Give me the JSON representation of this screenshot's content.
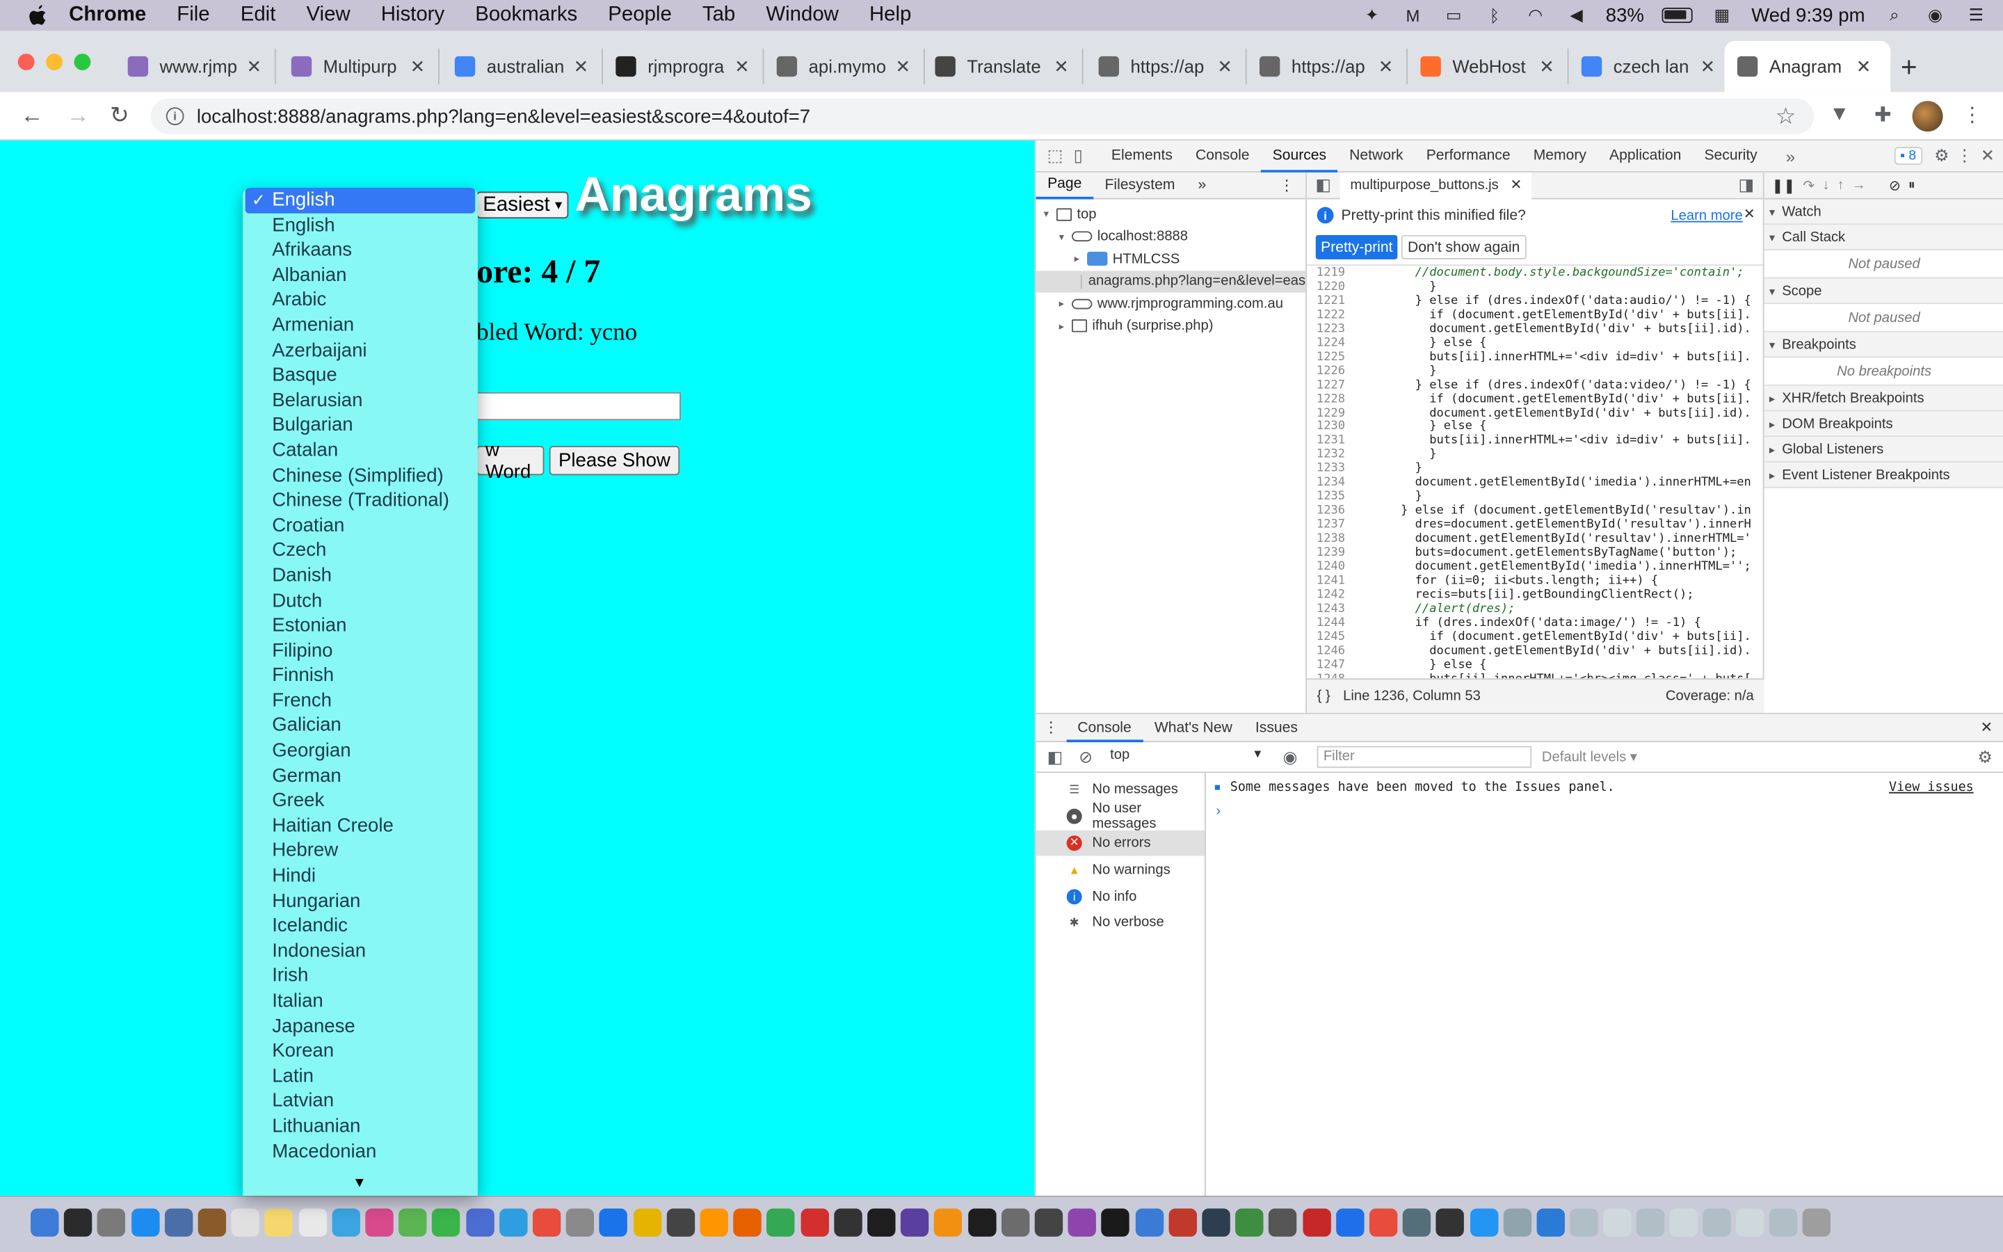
{
  "menubar": {
    "app": "Chrome",
    "items": [
      "File",
      "Edit",
      "View",
      "History",
      "Bookmarks",
      "People",
      "Tab",
      "Window",
      "Help"
    ],
    "battery": "83%",
    "clock": "Wed 9:39 pm"
  },
  "tabs": [
    {
      "label": "www.rjmp",
      "icon": "rocket-icon",
      "color": "#8a6bbd"
    },
    {
      "label": "Multipurp",
      "icon": "rocket-icon",
      "color": "#8a6bbd"
    },
    {
      "label": "australian",
      "icon": "google-icon",
      "color": "#4285f4"
    },
    {
      "label": "rjmprogra",
      "icon": "a-icon",
      "color": "#222222"
    },
    {
      "label": "api.mymo",
      "icon": "globe-icon",
      "color": "#666666"
    },
    {
      "label": "Translate",
      "icon": "translate-icon",
      "color": "#444444"
    },
    {
      "label": "https://ap",
      "icon": "globe-icon",
      "color": "#666666"
    },
    {
      "label": "https://ap",
      "icon": "globe-icon",
      "color": "#666666"
    },
    {
      "label": "WebHost",
      "icon": "cpanel-icon",
      "color": "#ff6c2c"
    },
    {
      "label": "czech lan",
      "icon": "google-icon",
      "color": "#4285f4"
    },
    {
      "label": "Anagram",
      "icon": "globe-icon",
      "color": "#666666"
    }
  ],
  "address": {
    "url": "localhost:8888/anagrams.php?lang=en&level=easiest&score=4&outof=7"
  },
  "page": {
    "level_select": "Easiest",
    "heading": "Anagrams",
    "score_text": "ore: 4 / 7",
    "scrambled_text": "bled Word: ycno",
    "new_word_button": "w Word",
    "please_show_button": "Please Show"
  },
  "dropdown": {
    "selected": "English",
    "options": [
      "English",
      "Afrikaans",
      "Albanian",
      "Arabic",
      "Armenian",
      "Azerbaijani",
      "Basque",
      "Belarusian",
      "Bulgarian",
      "Catalan",
      "Chinese (Simplified)",
      "Chinese (Traditional)",
      "Croatian",
      "Czech",
      "Danish",
      "Dutch",
      "Estonian",
      "Filipino",
      "Finnish",
      "French",
      "Galician",
      "Georgian",
      "German",
      "Greek",
      "Haitian Creole",
      "Hebrew",
      "Hindi",
      "Hungarian",
      "Icelandic",
      "Indonesian",
      "Irish",
      "Italian",
      "Japanese",
      "Korean",
      "Latin",
      "Latvian",
      "Lithuanian",
      "Macedonian"
    ]
  },
  "devtools": {
    "tabs": [
      "Elements",
      "Console",
      "Sources",
      "Network",
      "Performance",
      "Memory",
      "Application",
      "Security"
    ],
    "active_tab": "Sources",
    "issues_count": "8",
    "nav_tabs": [
      "Page",
      "Filesystem"
    ],
    "tree": [
      {
        "label": "top",
        "depth": 0
      },
      {
        "label": "localhost:8888",
        "depth": 1
      },
      {
        "label": "HTMLCSS",
        "depth": 2
      },
      {
        "label": "anagrams.php?lang=en&level=eas",
        "depth": 2
      },
      {
        "label": "www.rjmprogramming.com.au",
        "depth": 1
      },
      {
        "label": "ifhuh (surprise.php)",
        "depth": 1
      }
    ],
    "editor_file": "multipurpose_buttons.js",
    "pretty_prompt": "Pretty-print this minified file?",
    "learn_more": "Learn more",
    "pretty_btn": "Pretty-print",
    "dont_show_btn": "Don't show again",
    "line_numbers": [
      "1219",
      "1220",
      "1221",
      "1222",
      "1223",
      "1224",
      "1225",
      "1226",
      "1227",
      "1228",
      "1229",
      "1230",
      "1231",
      "1232",
      "1233",
      "1234",
      "1235",
      "1236",
      "1237",
      "1238",
      "1239",
      "1240",
      "1241",
      "1242",
      "1243",
      "1244",
      "1245",
      "1246",
      "1247",
      "1248"
    ],
    "code_lines": [
      "        //document.body.style.backgoundSize='contain';",
      "          }",
      "        } else if (dres.indexOf('data:audio/') != -1) {",
      "          if (document.getElementById('div' + buts[ii].",
      "          document.getElementById('div' + buts[ii].id).",
      "          } else {",
      "          buts[ii].innerHTML+='<div id=div' + buts[ii].",
      "          }",
      "        } else if (dres.indexOf('data:video/') != -1) {",
      "          if (document.getElementById('div' + buts[ii].",
      "          document.getElementById('div' + buts[ii].id).",
      "          } else {",
      "          buts[ii].innerHTML+='<div id=div' + buts[ii].",
      "          }",
      "        }",
      "        document.getElementById('imedia').innerHTML+=en",
      "        }",
      "      } else if (document.getElementById('resultav').in",
      "        dres=document.getElementById('resultav').innerH",
      "        document.getElementById('resultav').innerHTML='",
      "        buts=document.getElementsByTagName('button');",
      "        document.getElementById('imedia').innerHTML='';",
      "        for (ii=0; ii<buts.length; ii++) {",
      "        recis=buts[ii].getBoundingClientRect();",
      "        //alert(dres);",
      "        if (dres.indexOf('data:image/') != -1) {",
      "          if (document.getElementById('div' + buts[ii].",
      "          document.getElementById('div' + buts[ii].id).",
      "          } else {",
      "          buts[ii].innerHTML+='<br><img class=' + buts["
    ],
    "status_position": "Line 1236, Column 53",
    "coverage": "Coverage: n/a",
    "debug_sections": [
      {
        "label": "Watch",
        "open": true,
        "body": ""
      },
      {
        "label": "Call Stack",
        "open": true,
        "body": "Not paused"
      },
      {
        "label": "Scope",
        "open": true,
        "body": "Not paused"
      },
      {
        "label": "Breakpoints",
        "open": true,
        "body": "No breakpoints"
      },
      {
        "label": "XHR/fetch Breakpoints",
        "open": false,
        "body": ""
      },
      {
        "label": "DOM Breakpoints",
        "open": false,
        "body": ""
      },
      {
        "label": "Global Listeners",
        "open": false,
        "body": ""
      },
      {
        "label": "Event Listener Breakpoints",
        "open": false,
        "body": ""
      }
    ],
    "drawer_tabs": [
      "Console",
      "What's New",
      "Issues"
    ],
    "console_context": "top",
    "filter_placeholder": "Filter",
    "levels": "Default levels ▾",
    "console_sidebar": [
      {
        "label": "No messages",
        "icon": "list-icon",
        "color": "#555555"
      },
      {
        "label": "No user messages",
        "icon": "user-icon",
        "color": "#555555"
      },
      {
        "label": "No errors",
        "icon": "error-icon",
        "color": "#d93025"
      },
      {
        "label": "No warnings",
        "icon": "warning-icon",
        "color": "#f2a600"
      },
      {
        "label": "No info",
        "icon": "info-icon",
        "color": "#1a73e8"
      },
      {
        "label": "No verbose",
        "icon": "bug-icon",
        "color": "#555555"
      }
    ],
    "console_message": "Some messages have been moved to the Issues panel.",
    "view_issues": "View issues"
  }
}
